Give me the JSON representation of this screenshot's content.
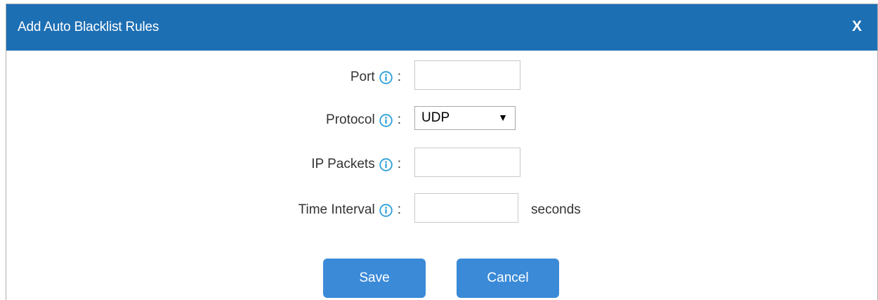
{
  "dialog": {
    "title": "Add Auto Blacklist Rules",
    "close_label": "X"
  },
  "form": {
    "port": {
      "label": "Port",
      "value": ""
    },
    "protocol": {
      "label": "Protocol",
      "value": "UDP"
    },
    "ip_packets": {
      "label": "IP Packets",
      "value": ""
    },
    "time_interval": {
      "label": "Time Interval",
      "value": "",
      "unit": "seconds"
    },
    "colon": ":"
  },
  "buttons": {
    "save": "Save",
    "cancel": "Cancel"
  },
  "colors": {
    "titlebar": "#1d6fb4",
    "button": "#3a8ad8",
    "info_icon": "#2a9fd8"
  }
}
